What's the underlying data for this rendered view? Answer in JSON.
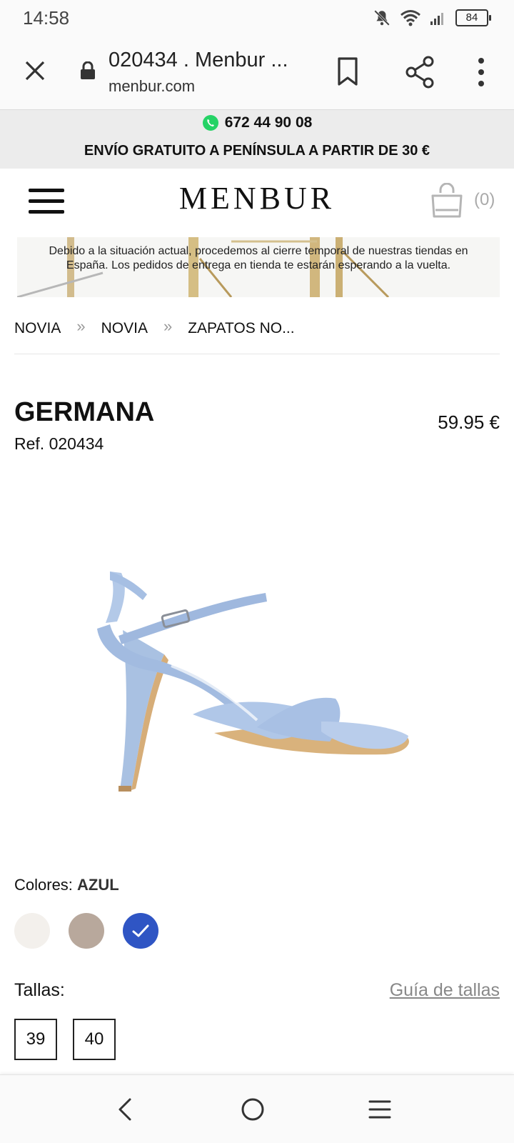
{
  "status_bar": {
    "time": "14:58",
    "battery": "84",
    "icons": [
      "notifications-off-icon",
      "wifi-icon",
      "signal-icon",
      "battery-icon"
    ]
  },
  "browser": {
    "title": "020434 . Menbur ...",
    "url": "menbur.com",
    "icons": [
      "close-icon",
      "lock-icon",
      "bookmark-icon",
      "share-icon",
      "more-vert-icon"
    ]
  },
  "promo": {
    "phone": "672 44 90 08",
    "phone_icon": "whatsapp-icon",
    "shipping": "ENVÍO GRATUITO A PENÍNSULA A PARTIR DE 30 €",
    "whatsapp_color": "#25d366"
  },
  "header": {
    "logo": "MENBUR",
    "cart_count": "(0)"
  },
  "notice": {
    "text": "Debido a la situación actual, procedemos al cierre temporal de nuestras tiendas en España. Los pedidos de entrega en tienda te estarán esperando a la vuelta."
  },
  "breadcrumb": {
    "items": [
      "NOVIA",
      "NOVIA",
      "ZAPATOS NO..."
    ],
    "separator": "»"
  },
  "product": {
    "name": "GERMANA",
    "ref": "Ref. 020434",
    "price": "59.95 €",
    "shoe_color": "#afc6e6"
  },
  "colors": {
    "label": "Colores:",
    "selected": "AZUL",
    "swatches": [
      {
        "color": "#f3f0ec",
        "selected": false
      },
      {
        "color": "#b8a89c",
        "selected": false
      },
      {
        "color": "#2f55c4",
        "selected": true
      }
    ]
  },
  "sizes": {
    "label": "Tallas:",
    "guide": "Guía de tallas",
    "options": [
      "39",
      "40"
    ]
  },
  "nav": {
    "icons": [
      "back-icon",
      "home-icon",
      "recents-icon"
    ]
  }
}
